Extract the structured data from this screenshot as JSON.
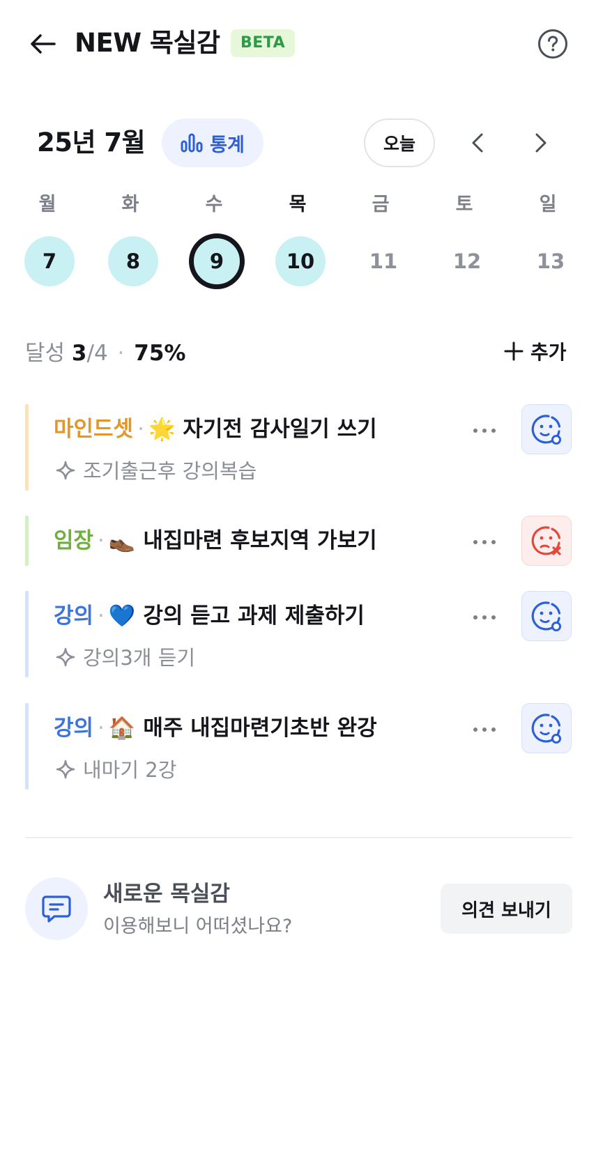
{
  "header": {
    "title": "NEW 목실감",
    "badge": "BETA"
  },
  "calendar": {
    "month_label": "25년 7월",
    "stats_label": "통계",
    "today_label": "오늘",
    "weekdays": [
      "월",
      "화",
      "수",
      "목",
      "금",
      "토",
      "일"
    ],
    "days": [
      "7",
      "8",
      "9",
      "10",
      "11",
      "12",
      "13"
    ],
    "selected_day": "9"
  },
  "summary": {
    "label": "달성",
    "done": "3",
    "slash": "/",
    "total": "4",
    "dot": "·",
    "percent": "75%",
    "add_label": "추가"
  },
  "goals": [
    {
      "category": "마인드셋",
      "sep": "·",
      "emoji": "🌟",
      "text": "자기전 감사일기 쓰기",
      "sub": "조기출근후 강의복습",
      "status": "done",
      "category_color": "#e3962a",
      "bar_color": "#f8e2c0"
    },
    {
      "category": "임장",
      "sep": "·",
      "emoji": "👞",
      "text": "내집마련 후보지역 가보기",
      "sub": "",
      "status": "fail",
      "category_color": "#6fae3f",
      "bar_color": "#d5efc4"
    },
    {
      "category": "강의",
      "sep": "·",
      "emoji": "💙",
      "text": "강의 듣고 과제 제출하기",
      "sub": "강의3개 듣기",
      "status": "done",
      "category_color": "#3b73e0",
      "bar_color": "#d6e2fa"
    },
    {
      "category": "강의",
      "sep": "·",
      "emoji": "🏠",
      "text": "매주 내집마련기초반 완강",
      "sub": "내마기 2강",
      "status": "done",
      "category_color": "#3b73e0",
      "bar_color": "#d6e2fa"
    }
  ],
  "feedback": {
    "title": "새로운 목실감",
    "subtitle": "이용해보니 어떠셨나요?",
    "button": "의견 보내기"
  },
  "colors": {
    "accent": "#2d5fd6",
    "day_fill": "#c9f1f3",
    "fail": "#e0493c"
  }
}
